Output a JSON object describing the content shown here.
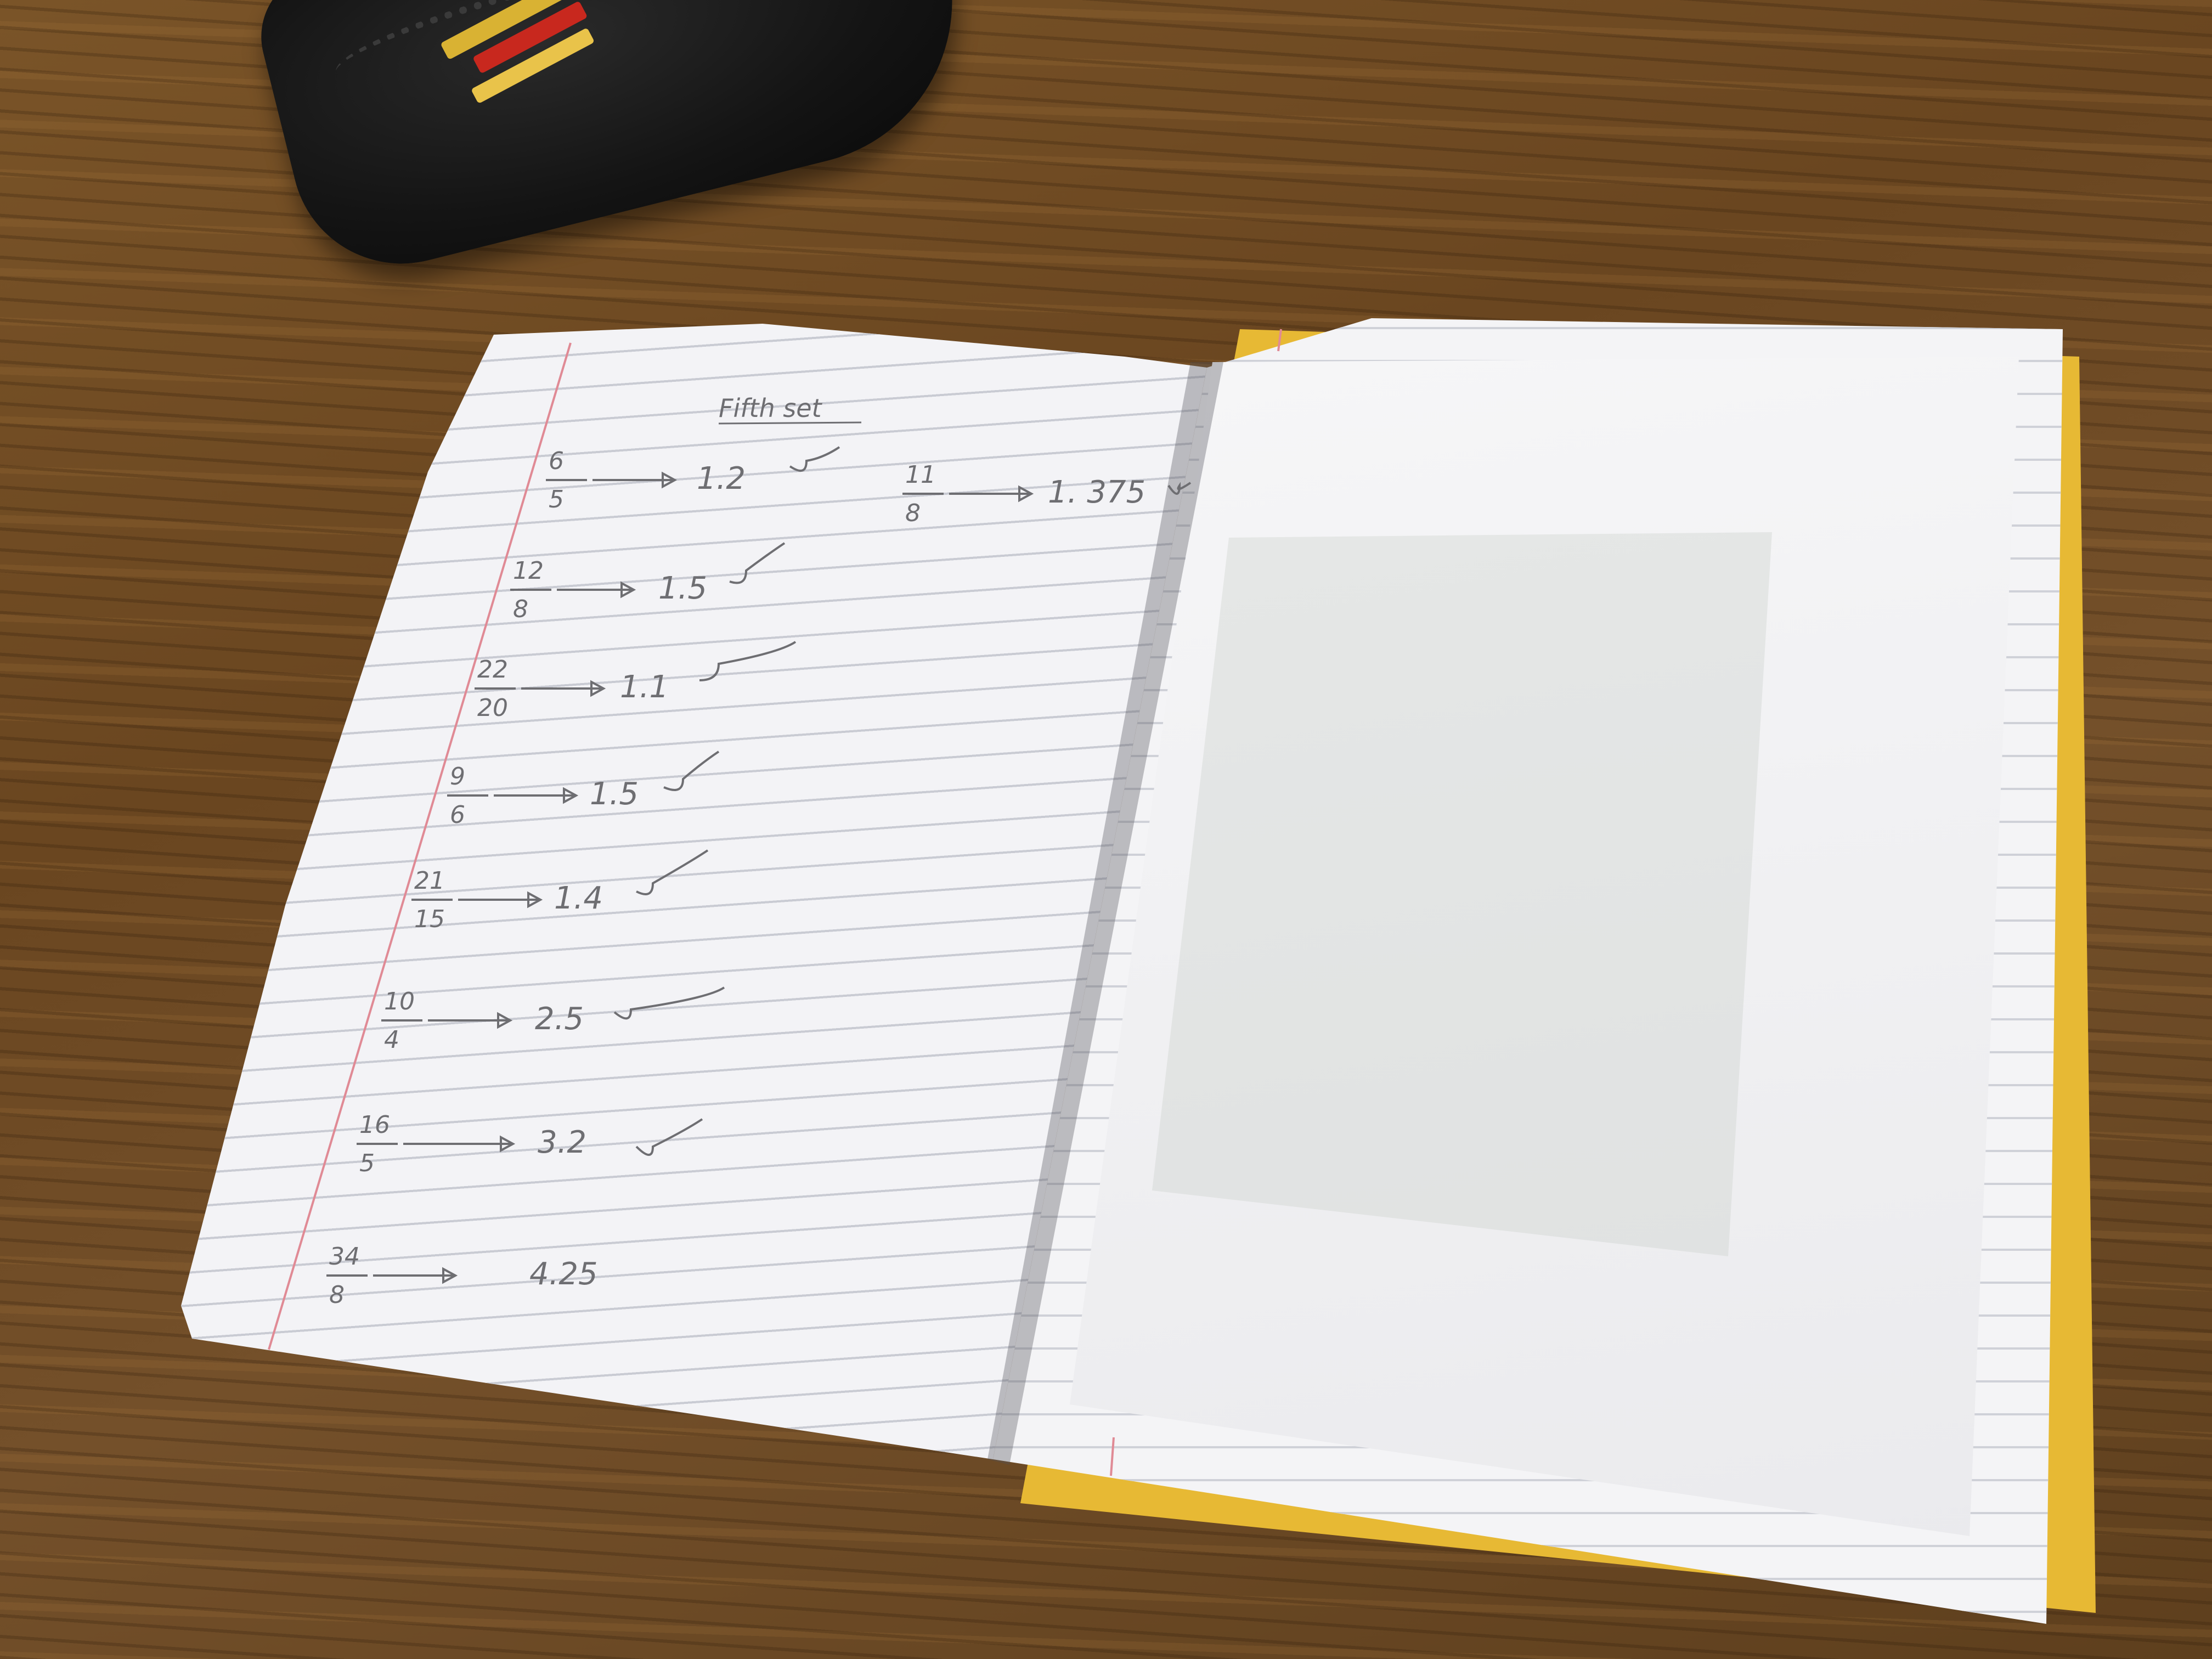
{
  "notebook": {
    "heading": "Fifth set",
    "exercises": [
      {
        "numerator": "6",
        "denominator": "5",
        "answer": "1.2",
        "checked": true
      },
      {
        "numerator": "11",
        "denominator": "8",
        "answer": "1. 375",
        "checked": true
      },
      {
        "numerator": "12",
        "denominator": "8",
        "answer": "1.5",
        "checked": true
      },
      {
        "numerator": "22",
        "denominator": "20",
        "answer": "1.1",
        "checked": true
      },
      {
        "numerator": "9",
        "denominator": "6",
        "answer": "1.5",
        "checked": true
      },
      {
        "numerator": "21",
        "denominator": "15",
        "answer": "1.4",
        "checked": true
      },
      {
        "numerator": "10",
        "denominator": "4",
        "answer": "2.5",
        "checked": true
      },
      {
        "numerator": "16",
        "denominator": "5",
        "answer": "3.2",
        "checked": true
      },
      {
        "numerator": "34",
        "denominator": "8",
        "answer": "4.25",
        "checked": false
      }
    ]
  },
  "colors": {
    "desk": "#6b4a22",
    "cover": "#e7b934",
    "page": "#f3f3f6",
    "rule_line": "#c9cbd3",
    "margin_line": "#e08a95",
    "pencil": "#6e6e72",
    "pencil_case": "#141414"
  }
}
